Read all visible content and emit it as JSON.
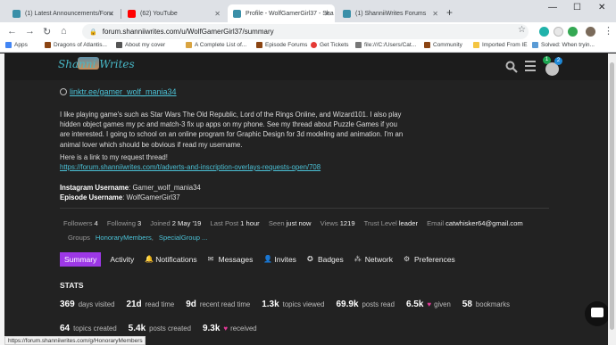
{
  "browser": {
    "tabs": [
      {
        "label": "(1) Latest Announcements/Foru",
        "favicon_color": "#3a8fa8"
      },
      {
        "label": "(62) YouTube",
        "favicon_color": "#ff0000"
      },
      {
        "label": "Profile - WolfGamerGirl37 - Sha",
        "favicon_color": "#3a8fa8"
      },
      {
        "label": "(1) ShanniiWrites Forums",
        "favicon_color": "#3a8fa8"
      }
    ],
    "url": "forum.shanniiwrites.com/u/WolfGamerGirl37/summary",
    "bookmarks": [
      "Apps",
      "Dragons of Atlantis...",
      "About my cover",
      "A Complete List of...",
      "Episode Forums",
      "Get Tickets",
      "file:///C:/Users/Cat...",
      "Community",
      "Imported From IE",
      "Solved: When tryin..."
    ],
    "status_url": "https://forum.shanniiwrites.com/g/HonoraryMembers"
  },
  "header": {
    "logo_text": "Shanni Writes",
    "notifications_count": "1",
    "messages_count": "2"
  },
  "profile": {
    "link": "linktr.ee/gamer_wolf_mania34",
    "bio": "I like playing game's such as Star Wars The Old Republic, Lord of the Rings Online, and Wizard101. I also play hidden object games my pc and match-3 fix up apps on my phone. See my thread about Puzzle Games if you are interested. I going to school on an online program for Graphic Design for 3d modeling and animation. I'm an animal lover which should be obvious if read my username.",
    "request_intro": "Here is a link to my request thread!",
    "request_link": "https://forum.shanniiwrites.com/t/adverts-and-inscription-overlays-requests-open/708",
    "instagram_label": "Instagram Username",
    "instagram_value": ": Gamer_wolf_mania34",
    "episode_label": "Episode Username",
    "episode_value": ": WolfGamerGirl37"
  },
  "meta": {
    "followers_label": "Followers",
    "followers": "4",
    "following_label": "Following",
    "following": "3",
    "joined_label": "Joined",
    "joined": "2 May '19",
    "last_post_label": "Last Post",
    "last_post": "1 hour",
    "seen_label": "Seen",
    "seen": "just now",
    "views_label": "Views",
    "views": "1219",
    "trust_label": "Trust Level",
    "trust": "leader",
    "email_label": "Email",
    "email": "catwhisker64@gmail.com",
    "groups_label": "Groups",
    "groups": [
      "HonoraryMembers",
      "SpecialGroup ..."
    ]
  },
  "nav": {
    "summary": "Summary",
    "activity": "Activity",
    "notifications": "Notifications",
    "messages": "Messages",
    "invites": "Invites",
    "badges": "Badges",
    "network": "Network",
    "preferences": "Preferences"
  },
  "stats": {
    "title": "STATS",
    "row1": [
      {
        "num": "369",
        "label": "days visited"
      },
      {
        "num": "21d",
        "label": "read time"
      },
      {
        "num": "9d",
        "label": "recent read time"
      },
      {
        "num": "1.3k",
        "label": "topics viewed"
      },
      {
        "num": "69.9k",
        "label": "posts read"
      },
      {
        "num": "6.5k",
        "label": "given"
      },
      {
        "num": "58",
        "label": "bookmarks"
      }
    ],
    "row2": [
      {
        "num": "64",
        "label": "topics created"
      },
      {
        "num": "5.4k",
        "label": "posts created"
      },
      {
        "num": "9.3k",
        "label": "received"
      }
    ]
  },
  "colors": {
    "accent": "#9d38e6",
    "link": "#4bc1d6",
    "heart": "#e33a98",
    "background": "#222222"
  }
}
